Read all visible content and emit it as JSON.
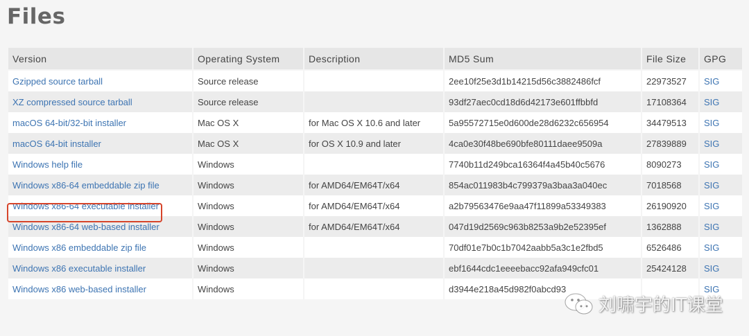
{
  "page": {
    "title": "Files"
  },
  "columns": [
    "Version",
    "Operating System",
    "Description",
    "MD5 Sum",
    "File Size",
    "GPG"
  ],
  "rows": [
    {
      "version": "Gzipped source tarball",
      "os": "Source release",
      "description": "",
      "md5": "2ee10f25e3d1b14215d56c3882486fcf",
      "size": "22973527",
      "gpg": "SIG"
    },
    {
      "version": "XZ compressed source tarball",
      "os": "Source release",
      "description": "",
      "md5": "93df27aec0cd18d6d42173e601ffbbfd",
      "size": "17108364",
      "gpg": "SIG"
    },
    {
      "version": "macOS 64-bit/32-bit installer",
      "os": "Mac OS X",
      "description": "for Mac OS X 10.6 and later",
      "md5": "5a95572715e0d600de28d6232c656954",
      "size": "34479513",
      "gpg": "SIG"
    },
    {
      "version": "macOS 64-bit installer",
      "os": "Mac OS X",
      "description": "for OS X 10.9 and later",
      "md5": "4ca0e30f48be690bfe80111daee9509a",
      "size": "27839889",
      "gpg": "SIG"
    },
    {
      "version": "Windows help file",
      "os": "Windows",
      "description": "",
      "md5": "7740b11d249bca16364f4a45b40c5676",
      "size": "8090273",
      "gpg": "SIG"
    },
    {
      "version": "Windows x86-64 embeddable zip file",
      "os": "Windows",
      "description": "for AMD64/EM64T/x64",
      "md5": "854ac011983b4c799379a3baa3a040ec",
      "size": "7018568",
      "gpg": "SIG"
    },
    {
      "version": "Windows x86-64 executable installer",
      "os": "Windows",
      "description": "for AMD64/EM64T/x64",
      "md5": "a2b79563476e9aa47f11899a53349383",
      "size": "26190920",
      "gpg": "SIG"
    },
    {
      "version": "Windows x86-64 web-based installer",
      "os": "Windows",
      "description": "for AMD64/EM64T/x64",
      "md5": "047d19d2569c963b8253a9b2e52395ef",
      "size": "1362888",
      "gpg": "SIG"
    },
    {
      "version": "Windows x86 embeddable zip file",
      "os": "Windows",
      "description": "",
      "md5": "70df01e7b0c1b7042aabb5a3c1e2fbd5",
      "size": "6526486",
      "gpg": "SIG"
    },
    {
      "version": "Windows x86 executable installer",
      "os": "Windows",
      "description": "",
      "md5": "ebf1644cdc1eeeebacc92afa949cfc01",
      "size": "25424128",
      "gpg": "SIG"
    },
    {
      "version": "Windows x86 web-based installer",
      "os": "Windows",
      "description": "",
      "md5": "d3944e218a45d982f0abcd93",
      "size": "",
      "gpg": "SIG"
    }
  ],
  "highlighted_row": "Windows x86-64 executable installer",
  "colors": {
    "link": "#3d74b2",
    "highlight": "#d6442a",
    "header_bg": "#e6e6e6"
  },
  "watermark": {
    "text": "刘啸宇的IT课堂",
    "icon": "wechat-icon"
  }
}
